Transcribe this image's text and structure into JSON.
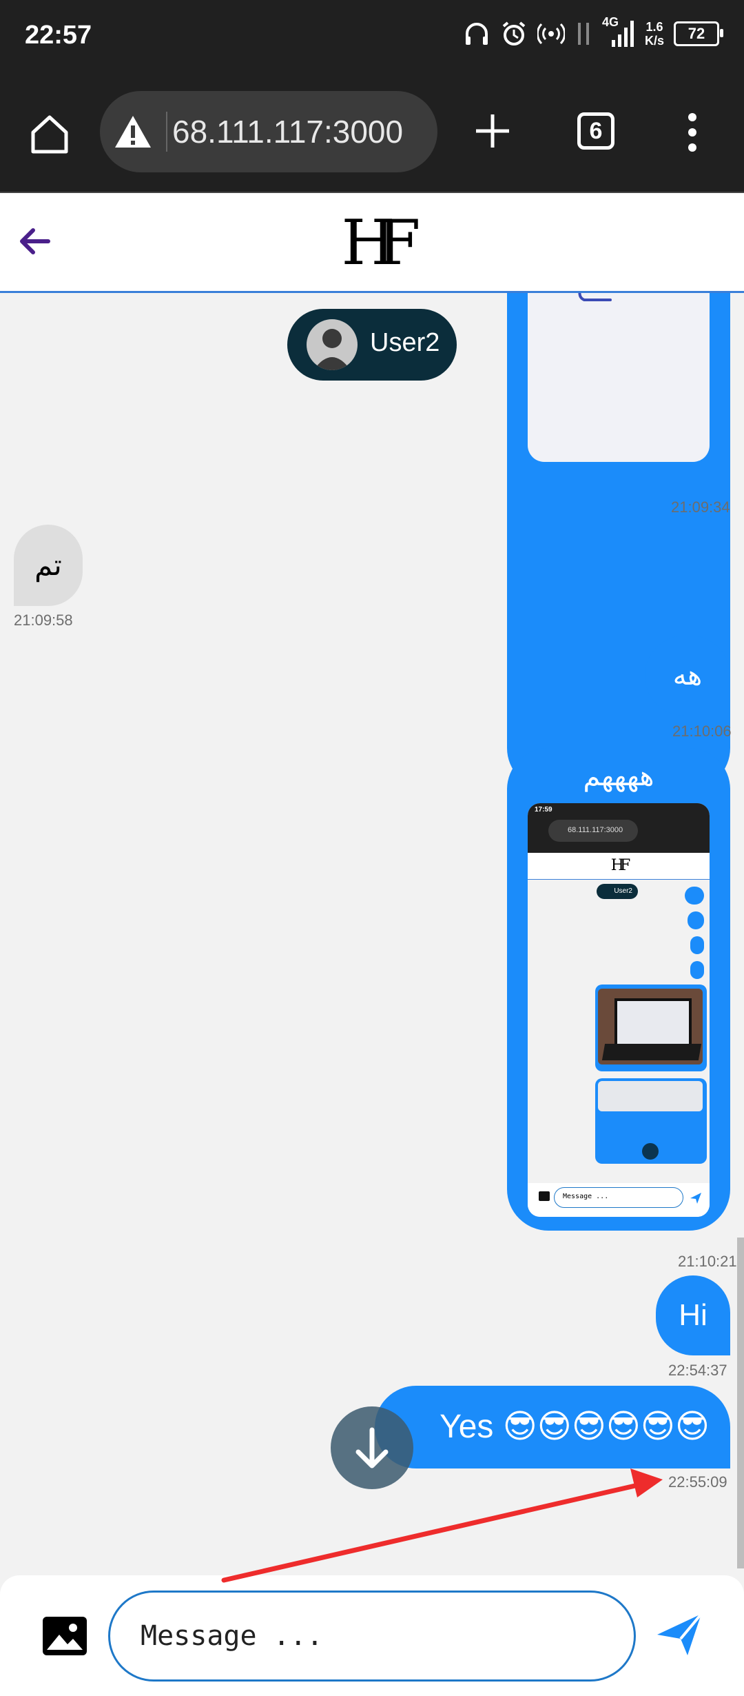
{
  "status_bar": {
    "time": "22:57",
    "network": "4G",
    "speed_value": "1.6",
    "speed_unit": "K/s",
    "battery": "72"
  },
  "browser": {
    "url": "68.111.117:3000",
    "tab_count": "6"
  },
  "header": {
    "logo": "HF"
  },
  "chat": {
    "user_chip_name": "User2",
    "messages": [
      {
        "side": "out",
        "type": "image",
        "time": "21:09:34"
      },
      {
        "side": "in",
        "type": "text",
        "text": "تم",
        "time": "21:09:58"
      },
      {
        "side": "out",
        "type": "text",
        "text": "هه",
        "time": "21:10:06"
      },
      {
        "side": "out",
        "type": "image",
        "caption": "ههههم",
        "time": "21:10:21"
      },
      {
        "side": "out",
        "type": "text",
        "text": "Hi",
        "time": "22:54:37"
      },
      {
        "side": "out",
        "type": "text",
        "text": "Yes 😎😎😎😎😎😎",
        "time": "22:55:09"
      }
    ]
  },
  "nested_screenshot": {
    "time": "17:59",
    "url": "68.111.117:3000",
    "logo": "HF",
    "user": "User2",
    "placeholder": "Message ..."
  },
  "compose": {
    "placeholder": "Message ..."
  },
  "colors": {
    "outgoing_bubble": "#1b8cfa",
    "incoming_bubble": "#dedede",
    "user_chip": "#0b2d3b",
    "annotation_arrow": "#ee2c2c"
  }
}
